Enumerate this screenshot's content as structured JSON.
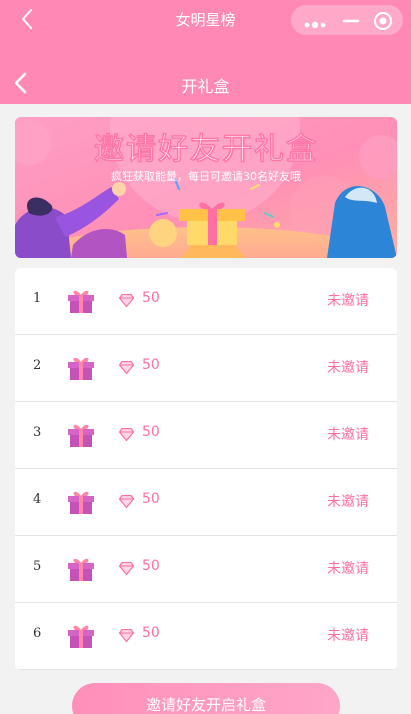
{
  "miniprogram": {
    "title": "女明星榜",
    "back_icon": "chevron-left-icon",
    "capsule_icons": [
      "more-dots-icon",
      "minimize-icon",
      "close-circle-icon"
    ]
  },
  "nav": {
    "title": "开礼盒",
    "back_icon": "chevron-left-icon"
  },
  "banner": {
    "headline": "邀请好友开礼盒",
    "subtitle": "疯狂获取能量，每日可邀请30名好友哦"
  },
  "gifts": [
    {
      "index": "1",
      "reward": "50",
      "status": "未邀请"
    },
    {
      "index": "2",
      "reward": "50",
      "status": "未邀请"
    },
    {
      "index": "3",
      "reward": "50",
      "status": "未邀请"
    },
    {
      "index": "4",
      "reward": "50",
      "status": "未邀请"
    },
    {
      "index": "5",
      "reward": "50",
      "status": "未邀请"
    },
    {
      "index": "6",
      "reward": "50",
      "status": "未邀请"
    }
  ],
  "action": {
    "invite_label": "邀请好友开启礼盒"
  },
  "colors": {
    "header": "#ff88b4",
    "accent_text": "#ff6fa4",
    "gift_box": "#c552b9",
    "gift_ribbon": "#ff86a6"
  }
}
